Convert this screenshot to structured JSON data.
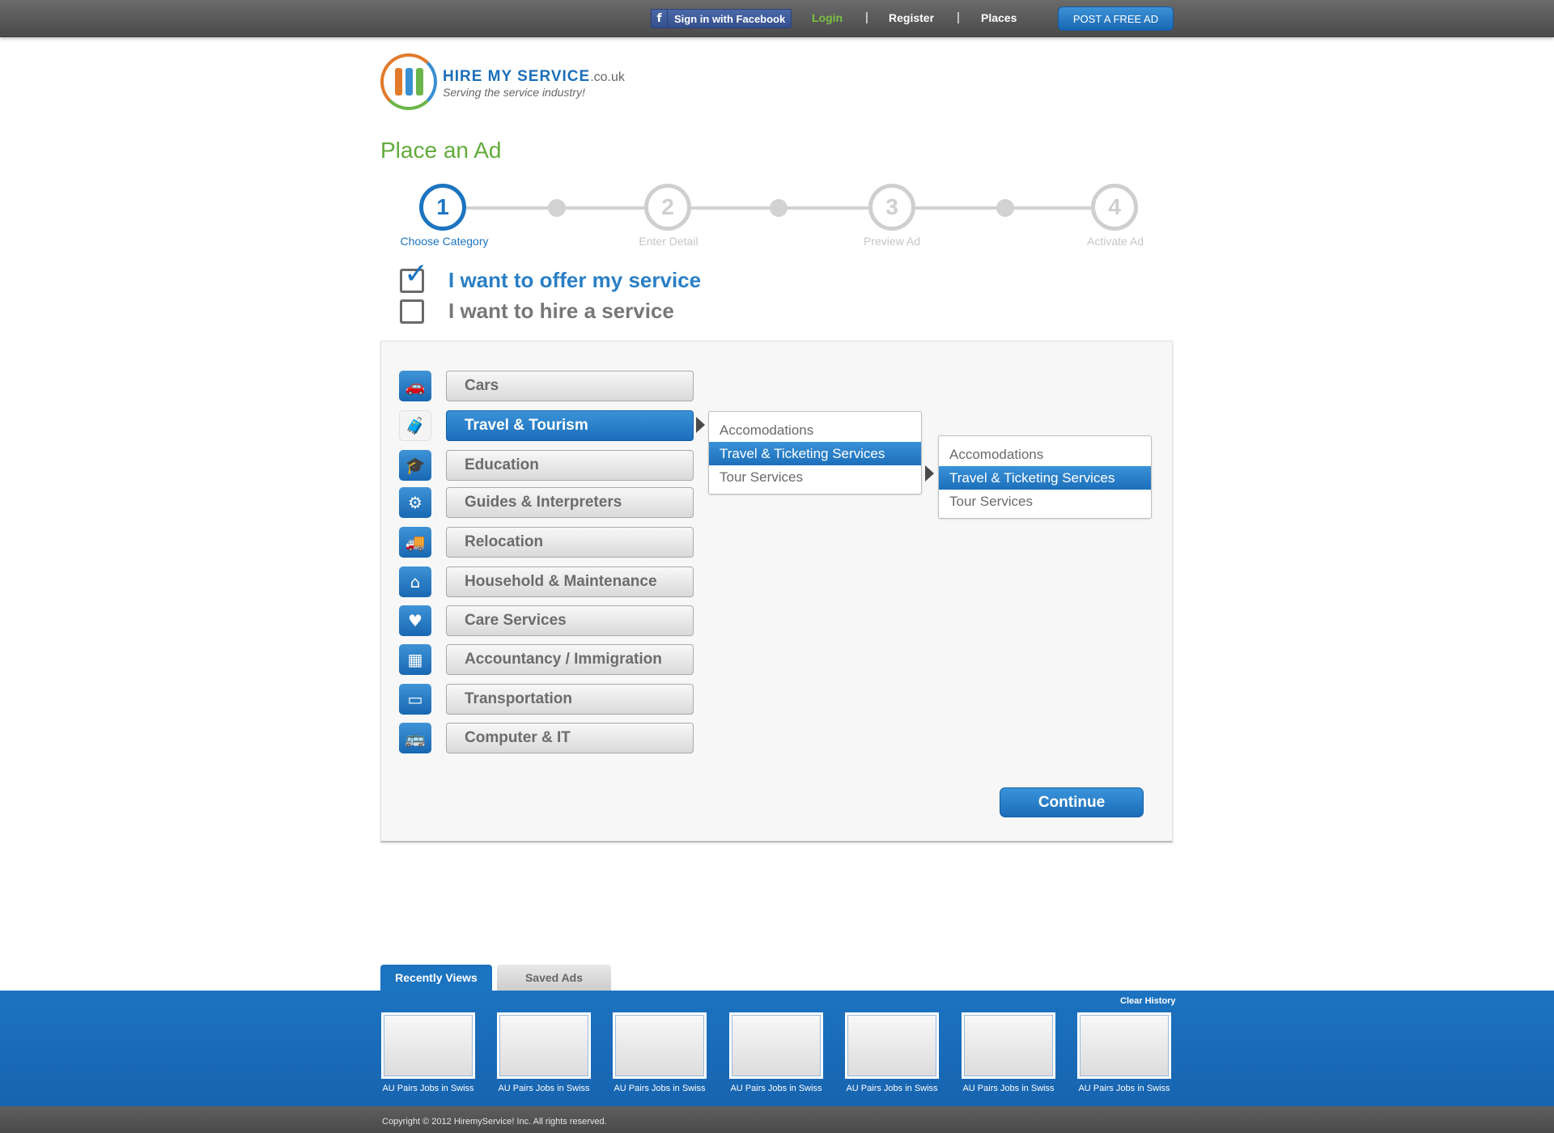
{
  "topbar": {
    "facebook_label": "Sign in with Facebook",
    "facebook_icon": "f",
    "login": "Login",
    "separator": "|",
    "register": "Register",
    "places": "Places",
    "post_ad": "POST A FREE AD"
  },
  "logo": {
    "name": "HIRE MY SERVICE",
    "tld": ".co.uk",
    "tagline": "Serving the service industry!"
  },
  "page_title": "Place an Ad",
  "steps": [
    {
      "number": "1",
      "label": "Choose Category",
      "active": true
    },
    {
      "number": "2",
      "label": "Enter Detail",
      "active": false
    },
    {
      "number": "3",
      "label": "Preview Ad",
      "active": false
    },
    {
      "number": "4",
      "label": "Activate Ad",
      "active": false
    }
  ],
  "choices": [
    {
      "label": "I want to offer my service",
      "checked": true
    },
    {
      "label": "I want to hire a service",
      "checked": false
    }
  ],
  "categories": [
    {
      "label": "Cars",
      "icon": "car-icon",
      "glyph": "🚗"
    },
    {
      "label": "Travel & Tourism",
      "icon": "traveler-icon",
      "glyph": "🧳",
      "active": true
    },
    {
      "label": "Education",
      "icon": "graduate-icon",
      "glyph": "🎓"
    },
    {
      "label": "Guides & Interpreters",
      "icon": "gear-wrench-icon",
      "glyph": "⚙"
    },
    {
      "label": "Relocation",
      "icon": "moving-truck-icon",
      "glyph": "🚚"
    },
    {
      "label": "Household & Maintenance",
      "icon": "house-icon",
      "glyph": "⌂"
    },
    {
      "label": "Care Services",
      "icon": "heart-cross-icon",
      "glyph": "♥"
    },
    {
      "label": "Accountancy / Immigration",
      "icon": "abacus-icon",
      "glyph": "▦"
    },
    {
      "label": "Transportation",
      "icon": "computer-icon",
      "glyph": "▭"
    },
    {
      "label": "Computer & IT",
      "icon": "bus-icon",
      "glyph": "🚌"
    }
  ],
  "submenu_1": {
    "items": [
      "Accomodations",
      "Travel & Ticketing Services",
      "Tour Services"
    ],
    "selected": 1
  },
  "submenu_2": {
    "items": [
      "Accomodations",
      "Travel & Ticketing Services",
      "Tour Services"
    ],
    "selected": 1
  },
  "continue_label": "Continue",
  "tabs": {
    "recent": "Recently Views",
    "saved": "Saved Ads"
  },
  "clear_history": "Clear History",
  "thumbnails": [
    "AU Pairs Jobs in Swiss",
    "AU Pairs Jobs in Swiss",
    "AU Pairs Jobs in Swiss",
    "AU Pairs Jobs in Swiss",
    "AU Pairs Jobs in Swiss",
    "AU Pairs Jobs in Swiss",
    "AU Pairs Jobs in Swiss"
  ],
  "copyright": "Copyright © 2012 HiremyService! Inc. All rights reserved.",
  "colors": {
    "brand_blue": "#1c74c0",
    "title_green": "#63ab3c",
    "login_green": "#7cc242"
  }
}
